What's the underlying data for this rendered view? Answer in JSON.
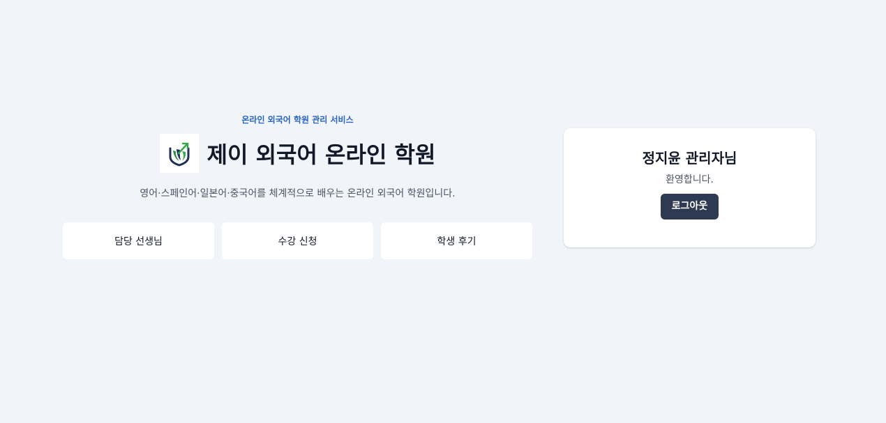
{
  "hero": {
    "tagline": "온라인 외국어 학원 관리 서비스",
    "title": "제이 외국어 온라인 학원",
    "description": "영어·스페인어·일본어·중국어를 체계적으로 배우는 온라인 외국어 학원입니다.",
    "logo_icon": "academy-logo",
    "nav": [
      {
        "label": "담당 선생님"
      },
      {
        "label": "수강 신청"
      },
      {
        "label": "학생 후기"
      }
    ]
  },
  "user_card": {
    "greeting": "정지윤 관리자님",
    "welcome": "환영합니다.",
    "logout_label": "로그아웃"
  },
  "colors": {
    "background": "#f1f4f8",
    "accent": "#2563c9",
    "logout_button": "#2d3a52",
    "logo_green": "#3aa64a",
    "logo_navy": "#1f2f57"
  }
}
